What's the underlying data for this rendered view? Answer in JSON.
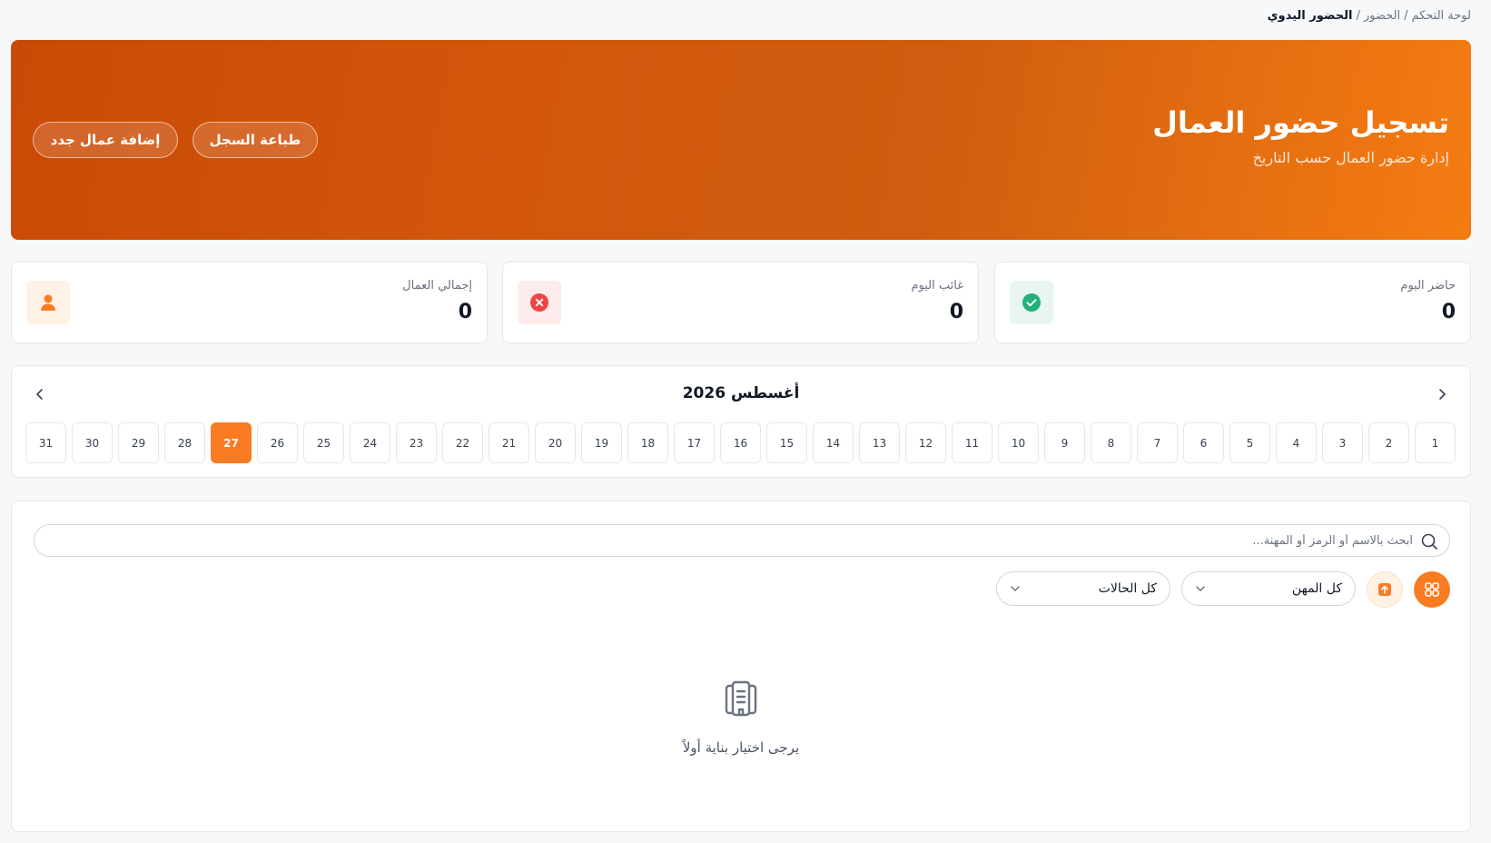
{
  "breadcrumb": {
    "home": "لوحة التحكم",
    "section": "الحضور",
    "current": "الحضور اليدوي",
    "separator": "/"
  },
  "banner": {
    "title": "تسجيل حضور العمال",
    "subtitle": "إدارة حضور العمال حسب التاريخ",
    "print_label": "طباعة السجل",
    "add_label": "إضافة عمال جدد"
  },
  "stats": {
    "present": {
      "label": "حاضر اليوم",
      "value": "0",
      "color": "#22b07d"
    },
    "absent": {
      "label": "غائب اليوم",
      "value": "0",
      "color": "#ef4444"
    },
    "total": {
      "label": "إجمالي العمال",
      "value": "0",
      "color": "#f97b22"
    }
  },
  "calendar": {
    "month_title": "أغسطس 2026",
    "selected_day": "27",
    "days": [
      "1",
      "2",
      "3",
      "4",
      "5",
      "6",
      "7",
      "8",
      "9",
      "10",
      "11",
      "12",
      "13",
      "14",
      "15",
      "16",
      "17",
      "18",
      "19",
      "20",
      "21",
      "22",
      "23",
      "24",
      "25",
      "26",
      "27",
      "28",
      "29",
      "30",
      "31"
    ]
  },
  "filters": {
    "search_placeholder": "ابحث بالاسم أو الرمز أو المهنة...",
    "profession_select": "كل المهن",
    "status_select": "كل الحالات"
  },
  "empty_state": {
    "message": "يرجى اختيار بناية أولاً",
    "icon": "building-icon"
  },
  "colors": {
    "accent": "#f97b22",
    "banner_start": "#c94a06",
    "banner_end": "#f57c12"
  }
}
